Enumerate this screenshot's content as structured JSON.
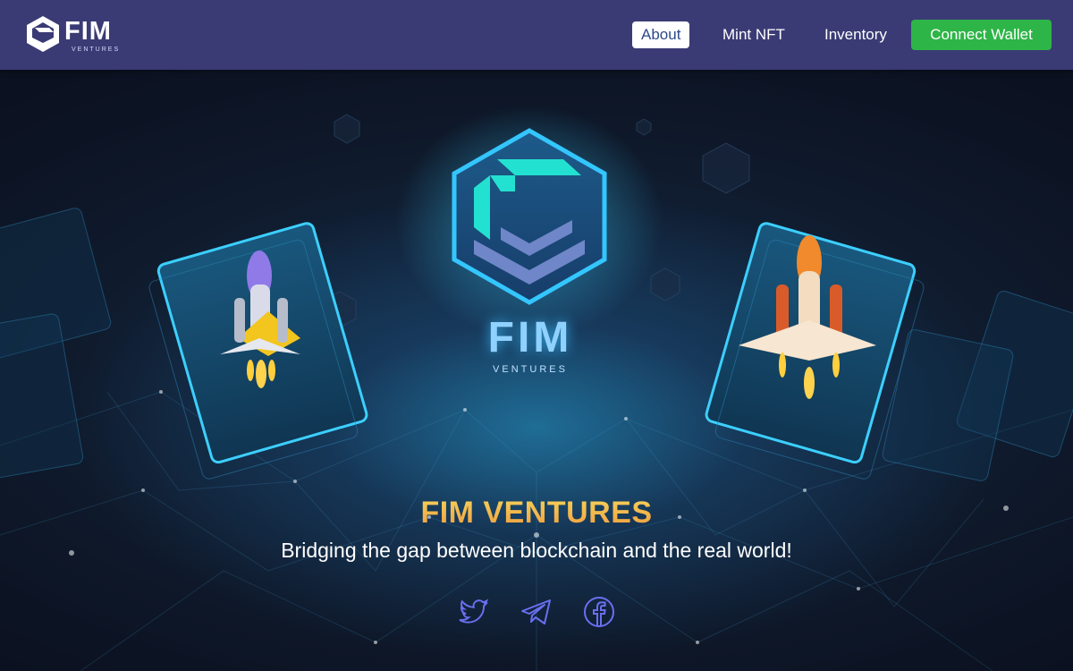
{
  "nav": {
    "logo_text": "FIM",
    "logo_subtext": "VENTURES",
    "links": [
      "About",
      "Mint NFT",
      "Inventory"
    ],
    "connect_label": "Connect Wallet",
    "active_link": "About"
  },
  "hero": {
    "emblem_text": "FIM",
    "emblem_subtext": "VENTURES",
    "title": "FIM VENTURES",
    "tagline": "Bridging the gap between blockchain and the real world!",
    "social_icons": [
      "twitter-icon",
      "telegram-icon",
      "facebook-icon"
    ]
  },
  "colors": {
    "navbar": "#3a3b75",
    "connect_button": "#2eb547",
    "title_gradient_top": "#f7d45c",
    "title_gradient_bottom": "#ef9b3d",
    "social_icon": "#6a6ff0",
    "emblem_glow": "#2ec2ff"
  }
}
